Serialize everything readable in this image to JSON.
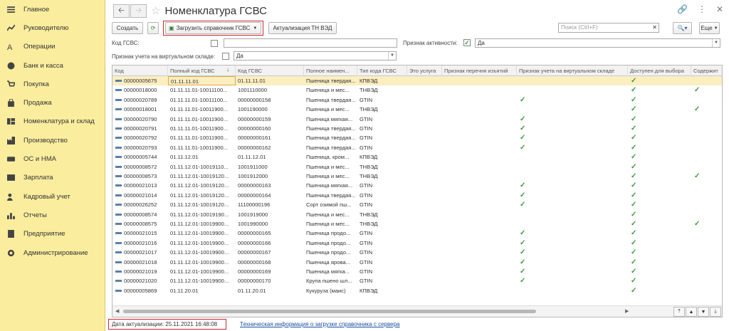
{
  "sidebar": {
    "items": [
      {
        "label": "Главное",
        "icon": "menu-icon"
      },
      {
        "label": "Руководителю",
        "icon": "chart-line-icon"
      },
      {
        "label": "Операции",
        "icon": "operations-icon"
      },
      {
        "label": "Банк и касса",
        "icon": "money-icon"
      },
      {
        "label": "Покупка",
        "icon": "cart-icon"
      },
      {
        "label": "Продажа",
        "icon": "bag-icon"
      },
      {
        "label": "Номенклатура и склад",
        "icon": "warehouse-icon"
      },
      {
        "label": "Производство",
        "icon": "factory-icon"
      },
      {
        "label": "ОС и НМА",
        "icon": "assets-icon"
      },
      {
        "label": "Зарплата",
        "icon": "salary-icon"
      },
      {
        "label": "Кадровый учет",
        "icon": "people-icon"
      },
      {
        "label": "Отчеты",
        "icon": "bar-chart-icon"
      },
      {
        "label": "Предприятие",
        "icon": "enterprise-icon"
      },
      {
        "label": "Администрирование",
        "icon": "gear-icon"
      }
    ]
  },
  "header": {
    "title": "Номенклатура ГСВС"
  },
  "toolbar": {
    "create_label": "Создать",
    "load_label": "Загрузить справочник ГСВС",
    "update_label": "Актуализация ТН ВЭД",
    "search_placeholder": "Поиск (Ctrl+F)",
    "more_label": "Еще"
  },
  "filters": {
    "code_label": "Код ГСВС:",
    "active_label": "Признак активности:",
    "active_value": "Да",
    "virtual_label": "Признак учета на виртуальном складе:",
    "virtual_value": "Да"
  },
  "table": {
    "columns": [
      "Код",
      "Полный код ГСВС",
      "Код ГСВС",
      "Полное наимен...",
      "Тип кода ГСВС",
      "Это услуга",
      "Признак перечня изъятий",
      "Признак учета на виртуальном складе",
      "Доступен для выбора",
      "Содержит"
    ],
    "rows": [
      {
        "code": "00000005675",
        "full": "01.11.11.01",
        "gcode": "01.11.11.01",
        "name": "Пшеница твердая...",
        "type": "КПВЭД",
        "virt": false,
        "avail": true,
        "cont": false
      },
      {
        "code": "00000018000",
        "full": "01.11.11.01-10011100...",
        "gcode": "1001110000",
        "name": "Пшеница и мес...",
        "type": "ТНВЭД",
        "virt": false,
        "avail": true,
        "cont": true
      },
      {
        "code": "00000020789",
        "full": "01.11.11.01-10011100...",
        "gcode": "00000000158",
        "name": "Пшеница твердая...",
        "type": "GTIN",
        "virt": true,
        "avail": true,
        "cont": false
      },
      {
        "code": "00000018001",
        "full": "01.11.11.01-10011900...",
        "gcode": "1001190000",
        "name": "Пшеница и мес...",
        "type": "ТНВЭД",
        "virt": false,
        "avail": true,
        "cont": true
      },
      {
        "code": "00000020790",
        "full": "01.11.11.01-10011900...",
        "gcode": "00000000159",
        "name": "Пшеница мягкая...",
        "type": "GTIN",
        "virt": true,
        "avail": true,
        "cont": false
      },
      {
        "code": "00000020791",
        "full": "01.11.11.01-10011900...",
        "gcode": "00000000160",
        "name": "Пшеница твердая...",
        "type": "GTIN",
        "virt": true,
        "avail": true,
        "cont": false
      },
      {
        "code": "00000020792",
        "full": "01.11.11.01-10011900...",
        "gcode": "00000000161",
        "name": "Пшеница твердая...",
        "type": "GTIN",
        "virt": true,
        "avail": true,
        "cont": false
      },
      {
        "code": "00000020793",
        "full": "01.11.11.01-10011900...",
        "gcode": "00000000162",
        "name": "Пшеница твердая...",
        "type": "GTIN",
        "virt": true,
        "avail": true,
        "cont": false
      },
      {
        "code": "00000005744",
        "full": "01.11.12.01",
        "gcode": "01.11.12.01",
        "name": "Пшеница, кром...",
        "type": "КПВЭД",
        "virt": false,
        "avail": true,
        "cont": false
      },
      {
        "code": "00000008572",
        "full": "01.11.12.01-10019110...",
        "gcode": "1001911000",
        "name": "Пшеница и мес...",
        "type": "ТНВЭД",
        "virt": false,
        "avail": true,
        "cont": false
      },
      {
        "code": "00000008573",
        "full": "01.11.12.01-10019120...",
        "gcode": "1001912000",
        "name": "Пшеница и мес...",
        "type": "ТНВЭД",
        "virt": false,
        "avail": true,
        "cont": true
      },
      {
        "code": "00000021013",
        "full": "01.11.12.01-10019120...",
        "gcode": "00000000163",
        "name": "Пшеница мягкая...",
        "type": "GTIN",
        "virt": true,
        "avail": true,
        "cont": false
      },
      {
        "code": "00000021014",
        "full": "01.11.12.01-10019120...",
        "gcode": "00000000164",
        "name": "Пшеница твердая...",
        "type": "GTIN",
        "virt": true,
        "avail": true,
        "cont": false
      },
      {
        "code": "00000026252",
        "full": "01.11.12.01-10019120...",
        "gcode": "11100000196",
        "name": "Сорт озимой пш...",
        "type": "GTIN",
        "virt": true,
        "avail": true,
        "cont": false
      },
      {
        "code": "00000008574",
        "full": "01.11.12.01-10019190...",
        "gcode": "1001919000",
        "name": "Пшеница и мес...",
        "type": "ТНВЭД",
        "virt": false,
        "avail": true,
        "cont": false
      },
      {
        "code": "00000008575",
        "full": "01.11.12.01-10019900...",
        "gcode": "1001990000",
        "name": "Пшеница и мес...",
        "type": "ТНВЭД",
        "virt": false,
        "avail": true,
        "cont": true
      },
      {
        "code": "00000021015",
        "full": "01.11.12.01-10019900...",
        "gcode": "00000000165",
        "name": "Пшеница продо...",
        "type": "GTIN",
        "virt": true,
        "avail": true,
        "cont": false
      },
      {
        "code": "00000021016",
        "full": "01.11.12.01-10019900...",
        "gcode": "00000000166",
        "name": "Пшеница продо...",
        "type": "GTIN",
        "virt": true,
        "avail": true,
        "cont": false
      },
      {
        "code": "00000021017",
        "full": "01.11.12.01-10019900...",
        "gcode": "00000000167",
        "name": "Пшеница продо...",
        "type": "GTIN",
        "virt": true,
        "avail": true,
        "cont": false
      },
      {
        "code": "00000021018",
        "full": "01.11.12.01-10019900...",
        "gcode": "00000000168",
        "name": "Пшеница ярова...",
        "type": "GTIN",
        "virt": true,
        "avail": true,
        "cont": false
      },
      {
        "code": "00000021019",
        "full": "01.11.12.01-10019900...",
        "gcode": "00000000169",
        "name": "Пшеница мягка...",
        "type": "GTIN",
        "virt": true,
        "avail": true,
        "cont": false
      },
      {
        "code": "00000021020",
        "full": "01.11.12.01-10019900...",
        "gcode": "00000000170",
        "name": "Крупа пшено шл...",
        "type": "GTIN",
        "virt": true,
        "avail": true,
        "cont": false
      },
      {
        "code": "00000005869",
        "full": "01.11.20.01",
        "gcode": "01.11.20.01",
        "name": "Кукуруза (маис)",
        "type": "КПВЭД",
        "virt": false,
        "avail": true,
        "cont": false
      }
    ]
  },
  "footer": {
    "date_label": "Дата актуализации: 25.11.2021 16:48:08",
    "link_label": "Техническая информация о загрузке справочника с сервера"
  },
  "colors": {
    "sidebar_bg": "#fbed9e",
    "selected_row": "#fbeec0",
    "check": "#3a9a3a",
    "highlight": "#d0262d",
    "link": "#1a4fa0"
  }
}
